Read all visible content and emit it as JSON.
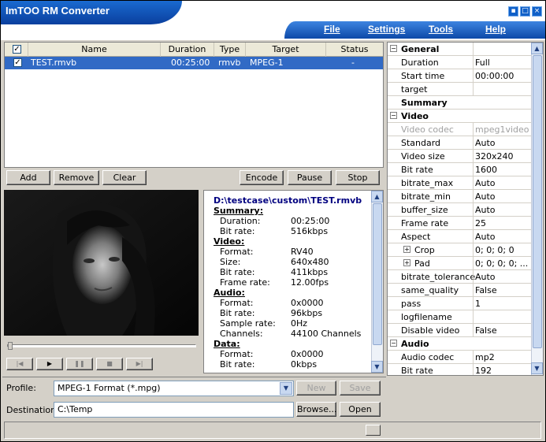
{
  "app": {
    "title": "ImTOO RM Converter"
  },
  "menu": {
    "file": "File",
    "settings": "Settings",
    "tools": "Tools",
    "help": "Help"
  },
  "window_buttons": {
    "minimize": "▪",
    "restore": "□",
    "close": "×"
  },
  "file_list": {
    "columns": [
      "Name",
      "Duration",
      "Type",
      "Target",
      "Status"
    ],
    "rows": [
      {
        "name": "TEST.rmvb",
        "duration": "00:25:00",
        "type": "rmvb",
        "target": "MPEG-1",
        "status": "-"
      }
    ]
  },
  "list_buttons": {
    "add": "Add",
    "remove": "Remove",
    "clear": "Clear",
    "encode": "Encode",
    "pause": "Pause",
    "stop": "Stop"
  },
  "player_controls": {
    "first": "|◀",
    "play": "▶",
    "pause": "❚❚",
    "stop": "■",
    "last": "▶|"
  },
  "info": {
    "path": "D:\\testcase\\custom\\TEST.rmvb",
    "summary_label": "Summary:",
    "summary": [
      {
        "k": "Duration:",
        "v": "00:25:00"
      },
      {
        "k": "Bit rate:",
        "v": "516kbps"
      }
    ],
    "video_label": "Video:",
    "video": [
      {
        "k": "Format:",
        "v": "RV40"
      },
      {
        "k": "Size:",
        "v": "640x480"
      },
      {
        "k": "Bit rate:",
        "v": "411kbps"
      },
      {
        "k": "Frame rate:",
        "v": "12.00fps"
      }
    ],
    "audio_label": "Audio:",
    "audio": [
      {
        "k": "Format:",
        "v": "0x0000"
      },
      {
        "k": "Bit rate:",
        "v": "96kbps"
      },
      {
        "k": "Sample rate:",
        "v": "0Hz"
      },
      {
        "k": "Channels:",
        "v": "44100 Channels"
      }
    ],
    "data_label": "Data:",
    "data": [
      {
        "k": "Format:",
        "v": "0x0000"
      },
      {
        "k": "Bit rate:",
        "v": "0kbps"
      }
    ]
  },
  "properties": [
    {
      "kind": "cat",
      "mark": "−",
      "name": "General",
      "value": ""
    },
    {
      "kind": "item",
      "name": "Duration",
      "value": "Full"
    },
    {
      "kind": "item",
      "name": "Start time",
      "value": "00:00:00"
    },
    {
      "kind": "item",
      "name": "target",
      "value": ""
    },
    {
      "kind": "cat",
      "mark": "",
      "name": "Summary",
      "value": ""
    },
    {
      "kind": "cat",
      "mark": "−",
      "name": "Video",
      "value": ""
    },
    {
      "kind": "dis",
      "name": "Video codec",
      "value": "mpeg1video"
    },
    {
      "kind": "item",
      "name": "Standard",
      "value": "Auto"
    },
    {
      "kind": "item",
      "name": "Video size",
      "value": "320x240"
    },
    {
      "kind": "item",
      "name": "Bit rate",
      "value": "1600"
    },
    {
      "kind": "item",
      "name": "bitrate_max",
      "value": "Auto"
    },
    {
      "kind": "item",
      "name": "bitrate_min",
      "value": "Auto"
    },
    {
      "kind": "item",
      "name": "buffer_size",
      "value": "Auto"
    },
    {
      "kind": "item",
      "name": "Frame rate",
      "value": "25"
    },
    {
      "kind": "item",
      "name": "Aspect",
      "value": "Auto"
    },
    {
      "kind": "sub",
      "mark": "+",
      "name": "Crop",
      "value": "0; 0; 0; 0"
    },
    {
      "kind": "sub",
      "mark": "+",
      "name": "Pad",
      "value": "0; 0; 0; 0; ..."
    },
    {
      "kind": "item",
      "name": "bitrate_tolerance",
      "value": "Auto"
    },
    {
      "kind": "item",
      "name": "same_quality",
      "value": "False"
    },
    {
      "kind": "item",
      "name": "pass",
      "value": "1"
    },
    {
      "kind": "item",
      "name": "logfilename",
      "value": ""
    },
    {
      "kind": "item",
      "name": "Disable video",
      "value": "False"
    },
    {
      "kind": "cat",
      "mark": "−",
      "name": "Audio",
      "value": ""
    },
    {
      "kind": "item",
      "name": "Audio codec",
      "value": "mp2"
    },
    {
      "kind": "item",
      "name": "Bit rate",
      "value": "192"
    }
  ],
  "bottom": {
    "profile_label": "Profile:",
    "profile_value": "MPEG-1 Format  (*.mpg)",
    "new": "New",
    "save": "Save",
    "destination_label": "Destination:",
    "destination_value": "C:\\Temp",
    "browse": "Browse...",
    "open": "Open"
  }
}
